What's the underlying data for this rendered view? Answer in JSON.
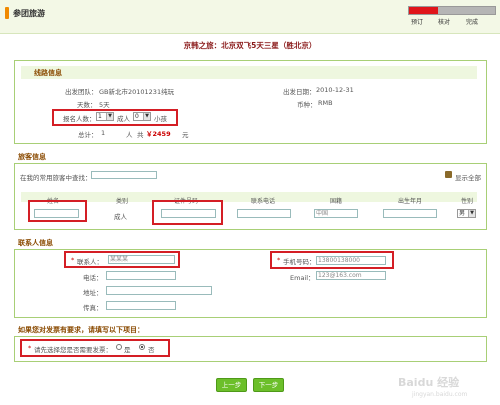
{
  "header": {
    "title": "参团旅游",
    "steps": [
      "预订",
      "核对",
      "完成"
    ],
    "progress": 0.34
  },
  "trip": {
    "title": "京韩之旅：北京双飞5天三星（胜北京）"
  },
  "route": {
    "section_title": "线路信息",
    "group_label": "出发团队：",
    "group_value": "GB新北市20101231纯玩",
    "date_label": "出发日期：",
    "date_value": "2010-12-31",
    "days_label": "天数：",
    "days_value": "5天",
    "currency_label": "币种：",
    "currency_value": "RMB",
    "count_label": "报名人数：",
    "adult_count": "1",
    "adult_label": "成人",
    "child_count": "0",
    "child_label": "小孩",
    "total_label": "总计：",
    "total_people": "1",
    "people_unit": "人",
    "total_word": "共",
    "total_price": "￥2459",
    "price_unit": "元"
  },
  "traveler": {
    "section_title": "旅客信息",
    "search_label": "在我的常用旅客中查找：",
    "show_all": "显示全部",
    "columns": [
      "姓名",
      "类别",
      "证件号码",
      "联系电话",
      "国籍",
      "出生年月",
      "性别"
    ],
    "row": {
      "category": "成人",
      "nationality": "中国",
      "gender": "男"
    }
  },
  "contact": {
    "section_title": "联系人信息",
    "name_label": "联系人：",
    "name_value": "某某某",
    "mobile_label": "手机号码：",
    "mobile_value": "13800138000",
    "phone_label": "电话：",
    "email_label": "Email：",
    "email_value": "123@163.com",
    "address_label": "地址：",
    "fax_label": "传真："
  },
  "invoice": {
    "section_title": "如果您对发票有要求，请填写以下项目：",
    "question": "请先选择您是否需要发票：",
    "yes": "是",
    "no": "否"
  },
  "buttons": {
    "prev": "上一步",
    "next": "下一步"
  },
  "watermark": "Baidu 经验",
  "watermark_url": "jingyan.baidu.com",
  "colors": {
    "accent": "#6cbf2a",
    "highlight": "#d41e25",
    "price": "#cc0000",
    "section": "#8a4a00"
  }
}
